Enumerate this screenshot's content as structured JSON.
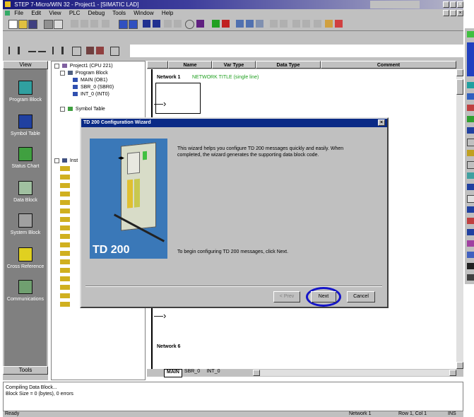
{
  "window": {
    "title": "STEP 7-Micro/WIN 32 - Project1 - [SIMATIC LAD]"
  },
  "menu": [
    "File",
    "Edit",
    "View",
    "PLC",
    "Debug",
    "Tools",
    "Window",
    "Help"
  ],
  "nav": {
    "header": "View",
    "items": [
      "Program Block",
      "Symbol Table",
      "Status Chart",
      "Data Block",
      "System Block",
      "Cross Reference",
      "Communications"
    ],
    "footer": "Tools"
  },
  "tree": {
    "project": "Project1 (CPU 221)",
    "program_block": "Program Block",
    "items": [
      "MAIN (OB1)",
      "SBR_0 (SBR0)",
      "INT_0 (INT0)"
    ],
    "symbol_table": "Symbol Table",
    "instr": "Inst"
  },
  "editor": {
    "columns": [
      "Name",
      "Var Type",
      "Data Type",
      "Comment"
    ],
    "network1_label": "Network 1",
    "network1_title": "NETWORK TITLE (single line)",
    "network6_label": "Network 6",
    "tabs": [
      "MAIN",
      "SBR_0",
      "INT_0"
    ]
  },
  "dialog": {
    "title": "TD 200 Configuration Wizard",
    "intro": "This wizard helps you configure TD 200 messages quickly and easily. When completed, the wizard generates the supporting data block code.",
    "instruction": "To begin configuring TD 200 messages, click Next.",
    "image_label": "TD 200",
    "back_label": "< Prev",
    "next_label": "Next",
    "cancel_label": "Cancel"
  },
  "output": {
    "lines": [
      "Compiling Data Block...",
      "Block Size = 0 (bytes), 0 errors"
    ]
  },
  "status": {
    "left": "Ready",
    "network": "Network 1",
    "position": "Row 1, Col 1",
    "mode": "INS"
  },
  "colors": {
    "titlebar": "#1a1a7a",
    "nav_bg": "#808080",
    "highlight_ring": "#1414c8",
    "window_bg": "#c0c0c0"
  }
}
